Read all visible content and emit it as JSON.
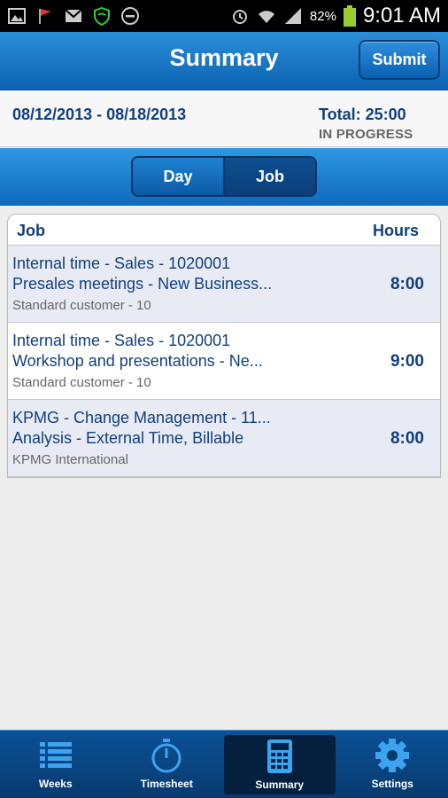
{
  "status_bar": {
    "battery": "82%",
    "time": "9:01 AM"
  },
  "header": {
    "title": "Summary",
    "submit_label": "Submit"
  },
  "summary": {
    "date_range": "08/12/2013 - 08/18/2013",
    "total": "Total: 25:00",
    "status": "IN PROGRESS"
  },
  "segments": {
    "day": "Day",
    "job": "Job"
  },
  "table": {
    "col_job": "Job",
    "col_hours": "Hours",
    "rows": [
      {
        "line1": "Internal time - Sales - 1020001",
        "line2": "Presales meetings - New Business...",
        "customer": "Standard customer - 10",
        "hours": "8:00"
      },
      {
        "line1": "Internal time - Sales - 1020001",
        "line2": "Workshop and presentations - Ne...",
        "customer": "Standard customer - 10",
        "hours": "9:00"
      },
      {
        "line1": "KPMG - Change Management - 11...",
        "line2": "Analysis - External Time, Billable",
        "customer": "KPMG International",
        "hours": "8:00"
      }
    ]
  },
  "tabs": {
    "weeks": "Weeks",
    "timesheet": "Timesheet",
    "summary": "Summary",
    "settings": "Settings"
  },
  "colors": {
    "brand_blue": "#0c62b2",
    "text_navy": "#123f7e",
    "tabbar": "#083a6e"
  }
}
